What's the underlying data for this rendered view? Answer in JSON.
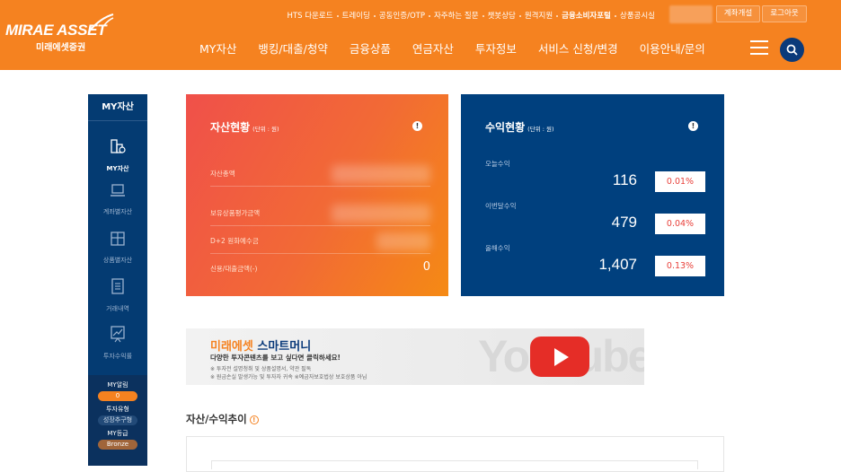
{
  "header": {
    "logo_en": "MIRAE ASSET",
    "logo_ko": "미래에셋증권",
    "top_links": [
      {
        "label": "HTS 다운로드",
        "bold": false
      },
      {
        "label": "트레이딩",
        "bold": false
      },
      {
        "label": "공동인증/OTP",
        "bold": false
      },
      {
        "label": "자주하는 질문",
        "bold": false
      },
      {
        "label": "챗봇상담",
        "bold": false
      },
      {
        "label": "원격지원",
        "bold": false
      },
      {
        "label": "금융소비자포털",
        "bold": true
      },
      {
        "label": "상품공시실",
        "bold": false
      }
    ],
    "account_open_label": "계좌개설",
    "logout_label": "로그아웃",
    "gnb": [
      "MY자산",
      "뱅킹/대출/청약",
      "금융상품",
      "연금자산",
      "투자정보",
      "서비스 신청/변경",
      "이용안내/문의"
    ],
    "colors": {
      "brand_orange": "#f58220",
      "brand_navy": "#043b72"
    }
  },
  "sidebar": {
    "title": "MY자산",
    "items": [
      {
        "label": "MY자산",
        "icon": "building-chart-icon",
        "active": true
      },
      {
        "label": "계좌별자산",
        "icon": "laptop-icon",
        "active": false
      },
      {
        "label": "상품별자산",
        "icon": "gift-box-icon",
        "active": false
      },
      {
        "label": "거래내역",
        "icon": "document-list-icon",
        "active": false
      },
      {
        "label": "투자수익률",
        "icon": "line-chart-icon",
        "active": false
      }
    ],
    "bottom": {
      "alarm_label": "MY알림",
      "alarm_count": "0",
      "type_label": "투자유형",
      "type_value": "성장추구형",
      "grade_label": "MY등급",
      "grade_value": "Bronze"
    }
  },
  "asset_card": {
    "title": "자산현황",
    "unit": "(단위 : 원)",
    "rows": [
      {
        "label": "자산총액",
        "value": ""
      },
      {
        "label": "보유상품평가금액",
        "value": ""
      },
      {
        "label": "D+2 원화예수금",
        "value": ""
      },
      {
        "label": "신용/대출금액(-)",
        "value": "0"
      }
    ]
  },
  "profit_card": {
    "title": "수익현황",
    "unit": "(단위 : 원)",
    "rows": [
      {
        "label": "오늘수익",
        "value": "116",
        "rate": "0.01%"
      },
      {
        "label": "이번달수익",
        "value": "479",
        "rate": "0.04%"
      },
      {
        "label": "올해수익",
        "value": "1,407",
        "rate": "0.13%"
      }
    ]
  },
  "banner": {
    "title_orange": "미래에셋",
    "title_navy": "스마트머니",
    "subtitle": "다양한 투자콘텐츠를 보고 싶다면 클릭하세요!",
    "note1": "※ 투자전 설명청취 및 상품설명서, 약관 필독",
    "note2": "※ 원금손실 발생가능 및 투자자 귀속 ※예금자보호법상 보호상품 아님",
    "bg_word": "YouTube"
  },
  "trend": {
    "title": "자산/수익추이"
  }
}
